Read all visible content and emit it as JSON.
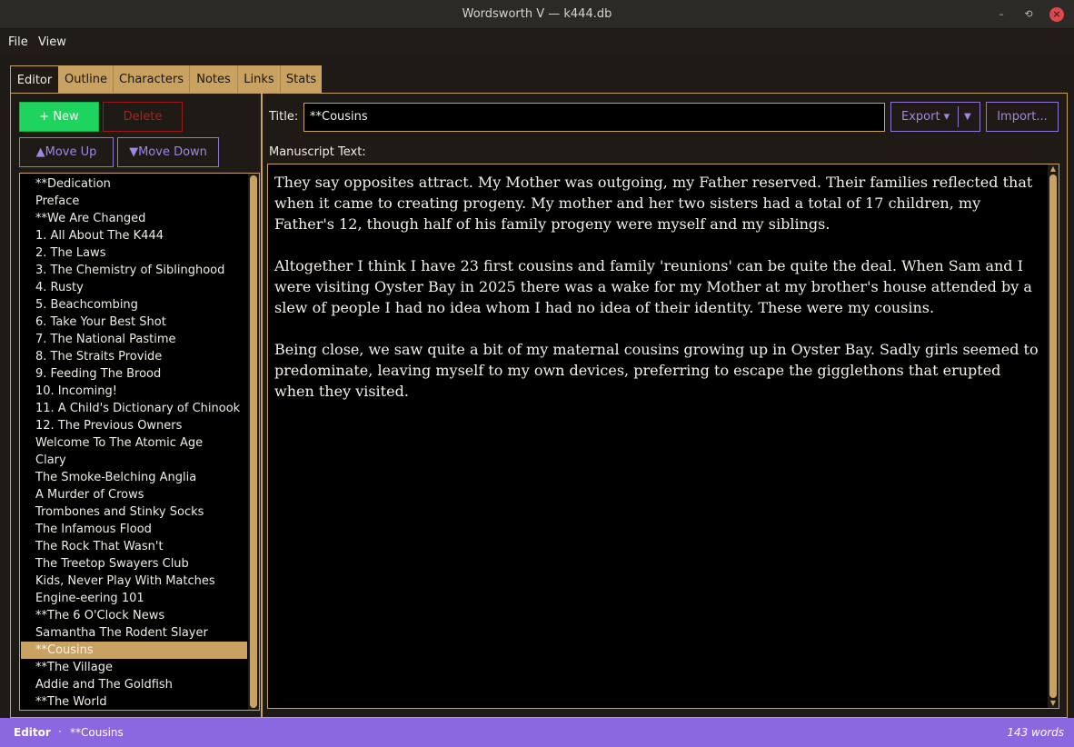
{
  "window": {
    "title": "Wordsworth V — k444.db",
    "minimize": "–",
    "maximize": "⟲",
    "close": "×"
  },
  "menu": [
    "File",
    "View"
  ],
  "tabs": [
    "Editor",
    "Outline",
    "Characters",
    "Notes",
    "Links",
    "Stats"
  ],
  "active_tab": "Editor",
  "buttons": {
    "new": "+ New",
    "delete": "Delete",
    "move_up": "▲Move Up",
    "move_down": "▼Move Down",
    "export": "Export ▾",
    "export_dropdown": "▼",
    "import": "Import..."
  },
  "chapters": [
    "**Dedication",
    "Preface",
    "**We Are Changed",
    "1. All About The K444",
    "2. The Laws",
    "3. The Chemistry of Siblinghood",
    "4. Rusty",
    "5. Beachcombing",
    "6. Take Your Best Shot",
    "7. The National Pastime",
    "8. The Straits Provide",
    "9. Feeding The Brood",
    "10. Incoming!",
    "11. A Child's Dictionary of Chinook",
    "12. The Previous Owners",
    "Welcome To The Atomic Age",
    "Clary",
    "The Smoke-Belching Anglia",
    "A Murder of Crows",
    "Trombones and Stinky Socks",
    "The Infamous Flood",
    "The Rock That Wasn't",
    "The Treetop Swayers Club",
    "Kids, Never Play With Matches",
    "Engine-eering 101",
    "**The 6 O'Clock News",
    "Samantha The Rodent Slayer",
    "**Cousins",
    "**The Village",
    "Addie and The Goldfish",
    "**The World"
  ],
  "selected_chapter": "**Cousins",
  "editor": {
    "title_label": "Title:",
    "title_value": "**Cousins",
    "manuscript_label": "Manuscript Text:",
    "paragraphs": [
      "They say opposites attract. My Mother was outgoing, my Father reserved. Their families reflected that when it came to creating progeny. My mother and her two sisters had a total of 17 children, my Father's 12, though half of his family progeny were myself and my siblings.",
      "Altogether I think I have 23 first cousins and family 'reunions' can be quite the deal. When Sam and I were visiting Oyster Bay in 2025 there was a wake for my Mother at my brother's house attended by a slew of people I had no idea whom I had no idea of their identity. These were my cousins.",
      "Being close, we saw quite a bit of my maternal cousins growing up in Oyster Bay. Sadly girls seemed to predominate, leaving myself to my own devices, preferring to escape the gigglethons that erupted when they visited."
    ]
  },
  "status": {
    "mode": "Editor",
    "separator": "·",
    "document": "**Cousins",
    "word_count": "143 words"
  },
  "colors": {
    "accent": "#c9a160",
    "purple": "#8c68e0",
    "green": "#1ed45e",
    "red": "#b81c1c",
    "background": "#1e1a15"
  },
  "icons": {
    "minimize": "minimize-icon",
    "maximize": "restore-icon",
    "close": "close-icon",
    "scroll_up": "scroll-up-arrow-icon",
    "scroll_down": "scroll-down-arrow-icon"
  }
}
